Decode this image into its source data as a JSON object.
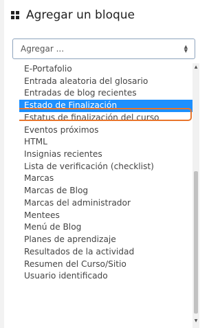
{
  "header": {
    "title": "Agregar un bloque",
    "icon": "blocks-icon"
  },
  "select": {
    "value": "Agregar ...",
    "icon": "select-arrows-icon"
  },
  "dropdown": {
    "options": [
      "E-Portafolio",
      "Entrada aleatoria del glosario",
      "Entradas de blog recientes",
      "Estado de Finalización",
      "Estatus de finalización del curso",
      "Eventos próximos",
      "HTML",
      "Insignias recientes",
      "Lista de verificación (checklist)",
      "Marcas",
      "Marcas de Blog",
      "Marcas del administrador",
      "Mentees",
      "Menú de Blog",
      "Planes de aprendizaje",
      "Resultados de la actividad",
      "Resumen del Curso/Sitio",
      "Usuario identificado"
    ],
    "selected_index": 3
  },
  "colors": {
    "selected_background": "#1e90ff",
    "highlight_outline": "#e8752c",
    "select_border": "#8da3bd"
  },
  "scrollbar": {
    "up_icon": "scroll-up-arrow-icon",
    "down_icon": "scroll-down-arrow-icon"
  }
}
